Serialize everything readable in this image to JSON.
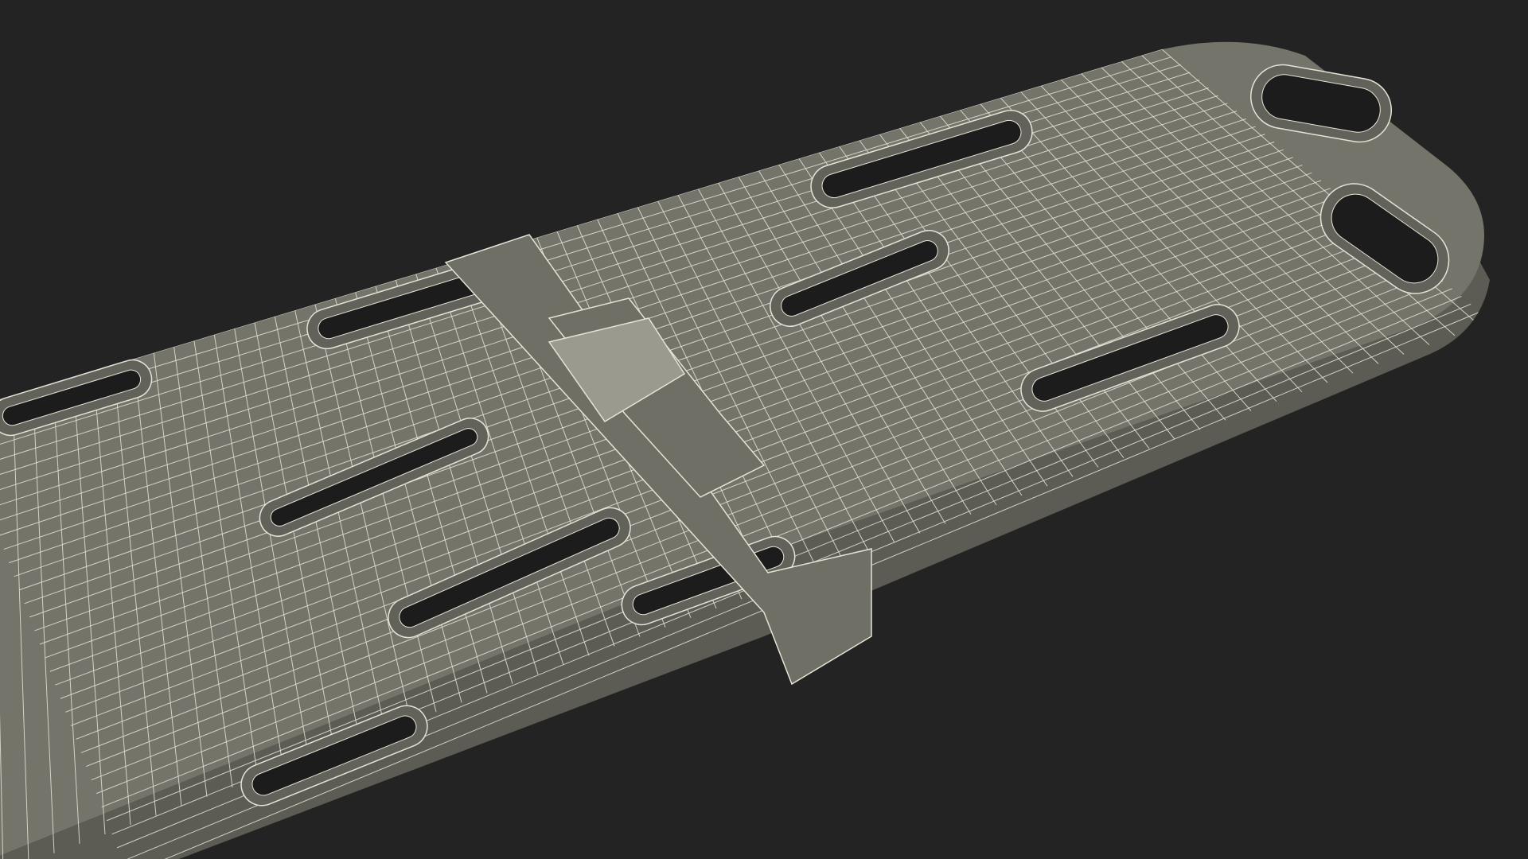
{
  "viewport": {
    "background": "#232323"
  },
  "model": {
    "subject": "spine-board-stretcher-wireframe",
    "surface_color": "#74746a",
    "surface_dark": "#5c5c54",
    "edge_color": "#62625a",
    "wire_color": "#e4e4d6",
    "hole_color": "#1c1c1c",
    "strap_color": "#6f6f66",
    "buckle_color": "#9a9a8e"
  }
}
